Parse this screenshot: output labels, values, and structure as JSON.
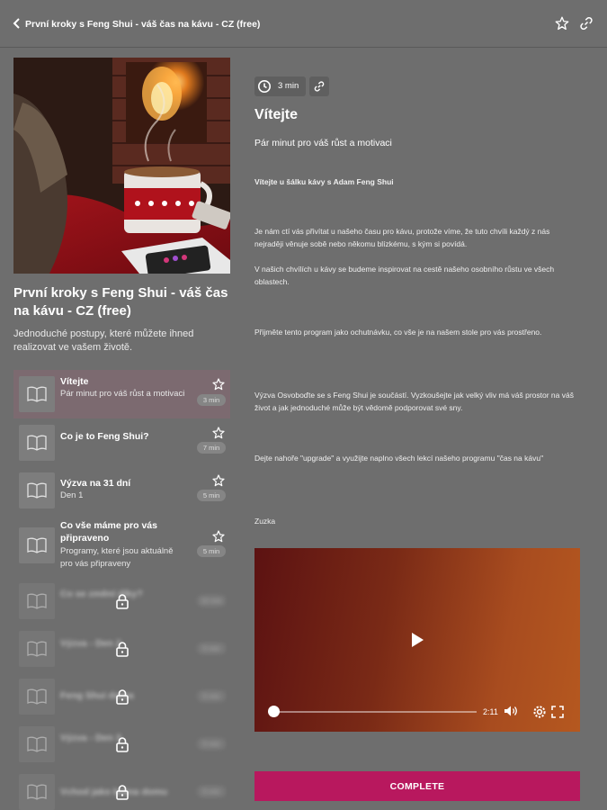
{
  "header": {
    "title": "První kroky s Feng Shui - váš čas na kávu - CZ (free)"
  },
  "course": {
    "title": "První kroky s Feng Shui - váš čas na kávu -  CZ (free)",
    "description": "Jednoduché postupy, které můžete ihned realizovat ve vašem životě."
  },
  "lessons": [
    {
      "title": "Vítejte",
      "subtitle": "Pár minut pro váš růst a motivaci",
      "duration": "3 min",
      "locked": false,
      "active": true
    },
    {
      "title": "Co je to Feng Shui?",
      "subtitle": "",
      "duration": "7 min",
      "locked": false,
      "active": false
    },
    {
      "title": "Výzva na 31 dní",
      "subtitle": "Den 1",
      "duration": "5 min",
      "locked": false,
      "active": false
    },
    {
      "title": "Co vše máme pro vás připraveno",
      "subtitle": "Programy, které jsou aktuálně pro vás připraveny",
      "duration": "5 min",
      "locked": false,
      "active": false
    },
    {
      "title": "Co se změní díky?",
      "subtitle": "",
      "duration": "10 min",
      "locked": true,
      "active": false
    },
    {
      "title": "Výzva - Den 2",
      "subtitle": "",
      "duration": "5 min",
      "locked": true,
      "active": false
    },
    {
      "title": "Feng Shui doma",
      "subtitle": "",
      "duration": "5 min",
      "locked": true,
      "active": false
    },
    {
      "title": "Výzva - Den 3",
      "subtitle": "",
      "duration": "5 min",
      "locked": true,
      "active": false
    },
    {
      "title": "Vchod jako brána domu",
      "subtitle": "",
      "duration": "5 min",
      "locked": true,
      "active": false
    }
  ],
  "content": {
    "duration": "3 min",
    "heading": "Vítejte",
    "subheading": "Pár minut pro váš růst a motivaci",
    "paragraphs": [
      "Vítejte u šálku kávy s Adam Feng Shui",
      "Je nám ctí vás přivítat u našeho času pro kávu, protože víme, že tuto chvíli každý z nás nejraději věnuje sobě nebo někomu blízkému, s kým si povídá.",
      "V našich chvílích u kávy se budeme inspirovat na cestě našeho osobního růstu ve všech oblastech.",
      "Přijměte tento program jako ochutnávku, co vše je na našem stole pro vás prostřeno.",
      "Výzva Osvoboďte se s Feng Shui je součástí. Vyzkoušejte jak velký vliv má váš prostor na váš život a jak jednoduché může být vědomě podporovat své sny.",
      "Dejte nahoře \"upgrade\" a využijte naplno všech lekcí našeho programu \"čas na kávu\"",
      "Zuzka"
    ],
    "video_time": "2:11",
    "video_progress": 0.0
  },
  "actions": {
    "complete_label": "COMPLETE"
  },
  "colors": {
    "background": "#6e6e6e",
    "accent": "#b8185e"
  }
}
